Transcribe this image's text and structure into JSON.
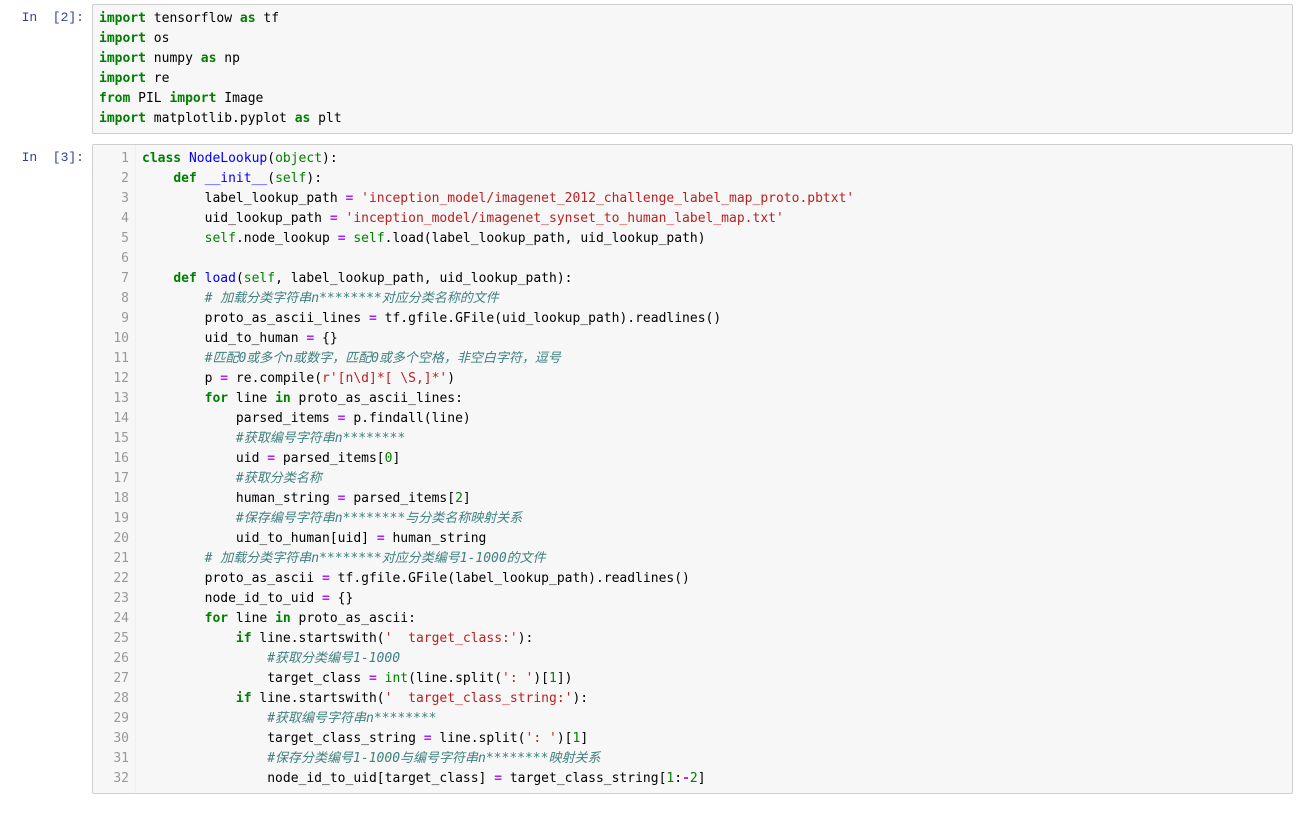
{
  "cell2": {
    "prompt": "In  [2]:",
    "lines": [
      [
        [
          "k",
          "import"
        ],
        [
          "n",
          " tensorflow "
        ],
        [
          "k",
          "as"
        ],
        [
          "n",
          " tf"
        ]
      ],
      [
        [
          "k",
          "import"
        ],
        [
          "n",
          " os"
        ]
      ],
      [
        [
          "k",
          "import"
        ],
        [
          "n",
          " numpy "
        ],
        [
          "k",
          "as"
        ],
        [
          "n",
          " np"
        ]
      ],
      [
        [
          "k",
          "import"
        ],
        [
          "n",
          " re"
        ]
      ],
      [
        [
          "k",
          "from"
        ],
        [
          "n",
          " PIL "
        ],
        [
          "k",
          "import"
        ],
        [
          "n",
          " Image"
        ]
      ],
      [
        [
          "k",
          "import"
        ],
        [
          "n",
          " matplotlib.pyplot "
        ],
        [
          "k",
          "as"
        ],
        [
          "n",
          " plt"
        ]
      ]
    ]
  },
  "cell3": {
    "prompt": "In  [3]:",
    "gutter_start": 1,
    "gutter_end": 32,
    "lines": [
      [
        [
          "k",
          "class"
        ],
        [
          "n",
          " "
        ],
        [
          "nf",
          "NodeLookup"
        ],
        [
          "n",
          "("
        ],
        [
          "bn",
          "object"
        ],
        [
          "n",
          "):"
        ]
      ],
      [
        [
          "n",
          "    "
        ],
        [
          "k",
          "def"
        ],
        [
          "n",
          " "
        ],
        [
          "nf",
          "__init__"
        ],
        [
          "n",
          "("
        ],
        [
          "self",
          "self"
        ],
        [
          "n",
          "):"
        ]
      ],
      [
        [
          "n",
          "        label_lookup_path "
        ],
        [
          "op",
          "="
        ],
        [
          "n",
          " "
        ],
        [
          "s",
          "'inception_model/imagenet_2012_challenge_label_map_proto.pbtxt'"
        ]
      ],
      [
        [
          "n",
          "        uid_lookup_path "
        ],
        [
          "op",
          "="
        ],
        [
          "n",
          " "
        ],
        [
          "s",
          "'inception_model/imagenet_synset_to_human_label_map.txt'"
        ]
      ],
      [
        [
          "n",
          "        "
        ],
        [
          "self",
          "self"
        ],
        [
          "n",
          ".node_lookup "
        ],
        [
          "op",
          "="
        ],
        [
          "n",
          " "
        ],
        [
          "self",
          "self"
        ],
        [
          "n",
          ".load(label_lookup_path, uid_lookup_path)"
        ]
      ],
      [
        [
          "n",
          " "
        ]
      ],
      [
        [
          "n",
          "    "
        ],
        [
          "k",
          "def"
        ],
        [
          "n",
          " "
        ],
        [
          "nf",
          "load"
        ],
        [
          "n",
          "("
        ],
        [
          "self",
          "self"
        ],
        [
          "n",
          ", label_lookup_path, uid_lookup_path):"
        ]
      ],
      [
        [
          "n",
          "        "
        ],
        [
          "c",
          "# 加载分类字符串n********对应分类名称的文件"
        ]
      ],
      [
        [
          "n",
          "        proto_as_ascii_lines "
        ],
        [
          "op",
          "="
        ],
        [
          "n",
          " tf.gfile.GFile(uid_lookup_path).readlines()"
        ]
      ],
      [
        [
          "n",
          "        uid_to_human "
        ],
        [
          "op",
          "="
        ],
        [
          "n",
          " {}"
        ]
      ],
      [
        [
          "n",
          "        "
        ],
        [
          "c",
          "#匹配0或多个n或数字，匹配0或多个空格，非空白字符，逗号"
        ]
      ],
      [
        [
          "n",
          "        p "
        ],
        [
          "op",
          "="
        ],
        [
          "n",
          " re.compile("
        ],
        [
          "s",
          "r'[n\\d]*[ \\S,]*'"
        ],
        [
          "n",
          ")"
        ]
      ],
      [
        [
          "n",
          "        "
        ],
        [
          "k",
          "for"
        ],
        [
          "n",
          " line "
        ],
        [
          "k",
          "in"
        ],
        [
          "n",
          " proto_as_ascii_lines:"
        ]
      ],
      [
        [
          "n",
          "            parsed_items "
        ],
        [
          "op",
          "="
        ],
        [
          "n",
          " p.findall(line)"
        ]
      ],
      [
        [
          "n",
          "            "
        ],
        [
          "c",
          "#获取编号字符串n********"
        ]
      ],
      [
        [
          "n",
          "            uid "
        ],
        [
          "op",
          "="
        ],
        [
          "n",
          " parsed_items["
        ],
        [
          "num",
          "0"
        ],
        [
          "n",
          "]"
        ]
      ],
      [
        [
          "n",
          "            "
        ],
        [
          "c",
          "#获取分类名称"
        ]
      ],
      [
        [
          "n",
          "            human_string "
        ],
        [
          "op",
          "="
        ],
        [
          "n",
          " parsed_items["
        ],
        [
          "num",
          "2"
        ],
        [
          "n",
          "]"
        ]
      ],
      [
        [
          "n",
          "            "
        ],
        [
          "c",
          "#保存编号字符串n********与分类名称映射关系"
        ]
      ],
      [
        [
          "n",
          "            uid_to_human[uid] "
        ],
        [
          "op",
          "="
        ],
        [
          "n",
          " human_string"
        ]
      ],
      [
        [
          "n",
          "        "
        ],
        [
          "c",
          "# 加载分类字符串n********对应分类编号1-1000的文件"
        ]
      ],
      [
        [
          "n",
          "        proto_as_ascii "
        ],
        [
          "op",
          "="
        ],
        [
          "n",
          " tf.gfile.GFile(label_lookup_path).readlines()"
        ]
      ],
      [
        [
          "n",
          "        node_id_to_uid "
        ],
        [
          "op",
          "="
        ],
        [
          "n",
          " {}"
        ]
      ],
      [
        [
          "n",
          "        "
        ],
        [
          "k",
          "for"
        ],
        [
          "n",
          " line "
        ],
        [
          "k",
          "in"
        ],
        [
          "n",
          " proto_as_ascii:"
        ]
      ],
      [
        [
          "n",
          "            "
        ],
        [
          "k",
          "if"
        ],
        [
          "n",
          " line.startswith("
        ],
        [
          "s",
          "'  target_class:'"
        ],
        [
          "n",
          "):"
        ]
      ],
      [
        [
          "n",
          "                "
        ],
        [
          "c",
          "#获取分类编号1-1000"
        ]
      ],
      [
        [
          "n",
          "                target_class "
        ],
        [
          "op",
          "="
        ],
        [
          "n",
          " "
        ],
        [
          "bn",
          "int"
        ],
        [
          "n",
          "(line.split("
        ],
        [
          "s",
          "': '"
        ],
        [
          "n",
          ")["
        ],
        [
          "num",
          "1"
        ],
        [
          "n",
          "])"
        ]
      ],
      [
        [
          "n",
          "            "
        ],
        [
          "k",
          "if"
        ],
        [
          "n",
          " line.startswith("
        ],
        [
          "s",
          "'  target_class_string:'"
        ],
        [
          "n",
          "):"
        ]
      ],
      [
        [
          "n",
          "                "
        ],
        [
          "c",
          "#获取编号字符串n********"
        ]
      ],
      [
        [
          "n",
          "                target_class_string "
        ],
        [
          "op",
          "="
        ],
        [
          "n",
          " line.split("
        ],
        [
          "s",
          "': '"
        ],
        [
          "n",
          ")["
        ],
        [
          "num",
          "1"
        ],
        [
          "n",
          "]"
        ]
      ],
      [
        [
          "n",
          "                "
        ],
        [
          "c",
          "#保存分类编号1-1000与编号字符串n********映射关系"
        ]
      ],
      [
        [
          "n",
          "                node_id_to_uid[target_class] "
        ],
        [
          "op",
          "="
        ],
        [
          "n",
          " target_class_string["
        ],
        [
          "num",
          "1"
        ],
        [
          "n",
          ":"
        ],
        [
          "op",
          "-"
        ],
        [
          "num",
          "2"
        ],
        [
          "n",
          "]"
        ]
      ]
    ]
  }
}
